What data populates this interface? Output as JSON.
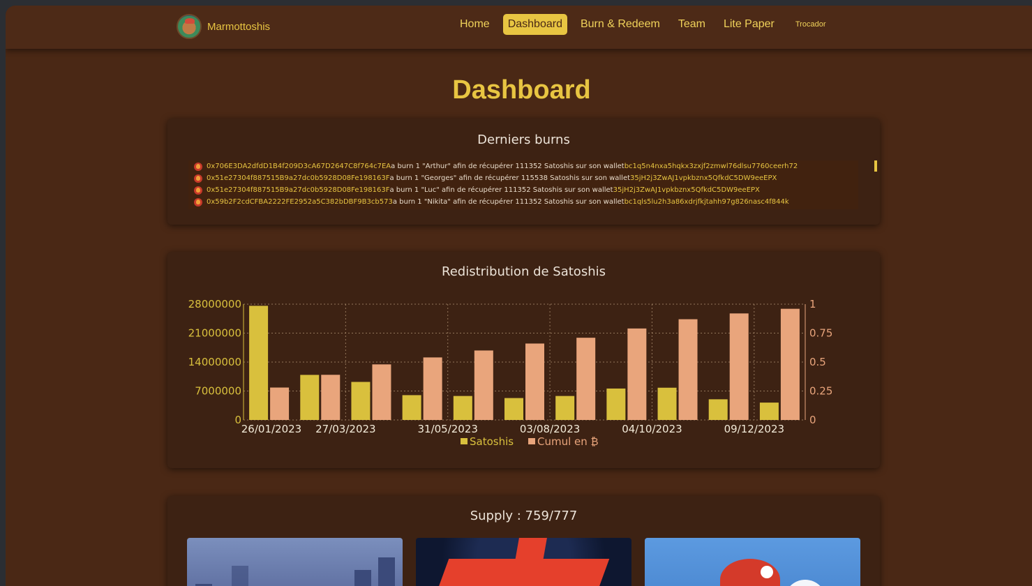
{
  "brand": {
    "name": "Marmottoshis"
  },
  "nav": {
    "items": [
      {
        "label": "Home",
        "active": false
      },
      {
        "label": "Dashboard",
        "active": true
      },
      {
        "label": "Burn & Redeem",
        "active": false
      },
      {
        "label": "Team",
        "active": false
      },
      {
        "label": "Lite Paper",
        "active": false
      },
      {
        "label": "Trocador",
        "active": false
      }
    ]
  },
  "page": {
    "title": "Dashboard"
  },
  "burns": {
    "title": "Derniers burns",
    "items": [
      {
        "address": "0x706E3DA2dfdD1B4f209D3cA67D2647C8f764c7EA",
        "text": " a burn 1 \"Arthur\" afin de récupérer 111352 Satoshis sur son wallet ",
        "wallet": "bc1q5n4nxa5hqkx3zxjf2zmwl76dlsu7760ceerh72"
      },
      {
        "address": "0x51e27304f887515B9a27dc0b5928D08Fe198163F",
        "text": " a burn 1 \"Georges\" afin de récupérer 115538 Satoshis sur son wallet ",
        "wallet": "35jH2j3ZwAJ1vpkbznx5QfkdC5DW9eeEPX"
      },
      {
        "address": "0x51e27304f887515B9a27dc0b5928D08Fe198163F",
        "text": " a burn 1 \"Luc\" afin de récupérer 111352 Satoshis sur son wallet ",
        "wallet": "35jH2j3ZwAJ1vpkbznx5QfkdC5DW9eeEPX"
      },
      {
        "address": "0x59b2F2cdCFBA2222FE2952a5C382bDBF9B3cb573",
        "text": " a burn 1 \"Nikita\" afin de récupérer 111352 Satoshis sur son wallet ",
        "wallet": "bc1qls5lu2h3a86xdrjfkjtahh97g826nasc4f844k"
      }
    ]
  },
  "chart": {
    "title": "Redistribution de Satoshis"
  },
  "chart_data": {
    "type": "bar",
    "title": "Redistribution de Satoshis",
    "xlabel": "",
    "ylabel": "",
    "tick_labels_x": [
      "26/01/2023",
      "27/03/2023",
      "31/05/2023",
      "03/08/2023",
      "04/10/2023",
      "09/12/2023"
    ],
    "y_left": {
      "ticks": [
        "0",
        "7000000",
        "14000000",
        "21000000",
        "28000000"
      ],
      "lim": [
        0,
        28000000
      ]
    },
    "y_right": {
      "ticks": [
        "0",
        "0.25",
        "0.5",
        "0.75",
        "1"
      ],
      "lim": [
        0,
        1
      ]
    },
    "series": [
      {
        "name": "Satoshis",
        "axis": "left",
        "color": "#d9c03d",
        "values": [
          27600000,
          10900000,
          9200000,
          6000000,
          5800000,
          5300000,
          5800000,
          7600000,
          7800000,
          5000000,
          4200000
        ]
      },
      {
        "name": "Cumul en ₿",
        "axis": "right",
        "color": "#e9a57c",
        "values": [
          0.28,
          0.39,
          0.48,
          0.54,
          0.6,
          0.66,
          0.71,
          0.79,
          0.87,
          0.92,
          0.96
        ]
      }
    ],
    "grid": true,
    "legend": "bottom"
  },
  "supply": {
    "title": "Supply : 759/777"
  }
}
